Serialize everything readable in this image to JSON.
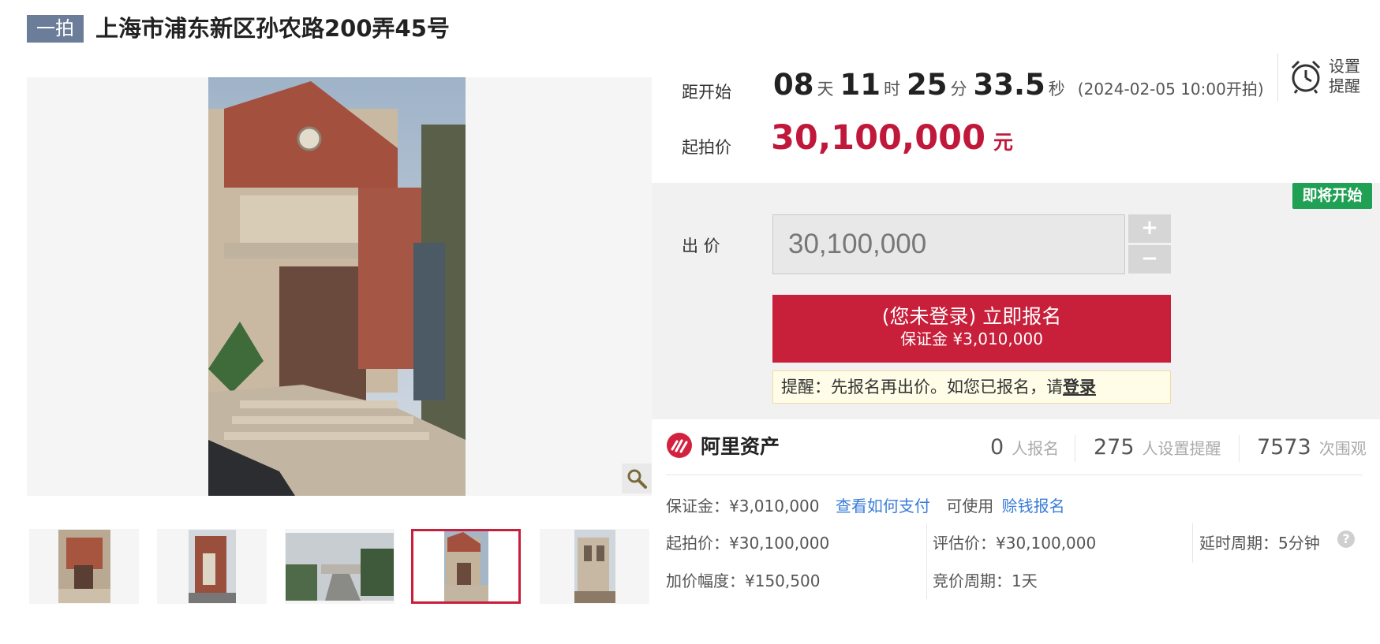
{
  "header": {
    "tag": "一拍",
    "title": "上海市浦东新区孙农路200弄45号"
  },
  "countdown": {
    "label": "距开始",
    "days": "08",
    "days_unit": "天",
    "hours": "11",
    "hours_unit": "时",
    "minutes": "25",
    "minutes_unit": "分",
    "seconds": "33.5",
    "seconds_unit": "秒",
    "start_time": "(2024-02-05 10:00开拍)"
  },
  "remind": {
    "label": "设置提醒",
    "icon": "alarm-clock-icon"
  },
  "start_price": {
    "label": "起拍价",
    "value": "30,100,000",
    "unit": "元"
  },
  "bid": {
    "badge": "即将开始",
    "label": "出 价",
    "input_value": "30,100,000",
    "plus": "+",
    "minus": "−",
    "signup_line1": "(您未登录) 立即报名",
    "signup_line2": "保证金 ¥3,010,000",
    "notice_text": "提醒：先报名再出价。如您已报名，请",
    "notice_link": "登录"
  },
  "stats": {
    "brand": "阿里资产",
    "signups": "0",
    "signups_label": "人报名",
    "reminders": "275",
    "reminders_label": "人设置提醒",
    "views": "7573",
    "views_label": "次围观"
  },
  "info": {
    "deposit": "保证金：¥3,010,000",
    "how_to_pay": "查看如何支付",
    "can_use": "可使用",
    "earn_signup": "赊钱报名",
    "start_price": "起拍价：¥30,100,000",
    "appraisal": "评估价：¥30,100,000",
    "delay_period": "延时周期：5分钟",
    "increment": "加价幅度：¥150,500",
    "bid_period": "竞价周期：1天"
  },
  "gallery": {
    "selected_thumb": 4,
    "thumb_count": 5
  },
  "colors": {
    "accent_red": "#c81f3a",
    "price_red": "#c0183a",
    "badge_green": "#1fa054",
    "tag_bg": "#6b7d99",
    "link_blue": "#3a7dd9"
  }
}
